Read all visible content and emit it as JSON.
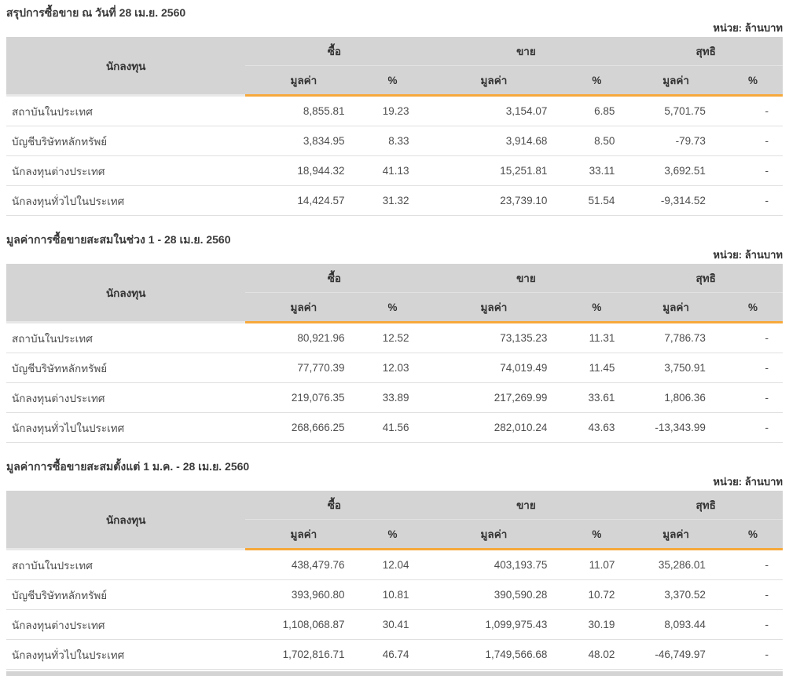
{
  "unit_label": "หน่วย: ล้านบาท",
  "columns": {
    "investor": "นักลงทุน",
    "buy": "ซื้อ",
    "sell": "ขาย",
    "net": "สุทธิ",
    "value": "มูลค่า",
    "percent": "%"
  },
  "colors": {
    "header_gray": "#d4d4d4",
    "accent_orange": "#f6a93b",
    "positive_green": "#109910",
    "negative_red": "#ff0000"
  },
  "sections": [
    {
      "title": "สรุปการซื้อขาย ณ วันที่ 28 เม.ย. 2560",
      "rows": [
        {
          "investor": "สถาบันในประเทศ",
          "buy_value": "8,855.81",
          "buy_pct": "19.23",
          "sell_value": "3,154.07",
          "sell_pct": "6.85",
          "net_value": "5,701.75",
          "net_pct": "-"
        },
        {
          "investor": "บัญชีบริษัทหลักทรัพย์",
          "buy_value": "3,834.95",
          "buy_pct": "8.33",
          "sell_value": "3,914.68",
          "sell_pct": "8.50",
          "net_value": "-79.73",
          "net_pct": "-"
        },
        {
          "investor": "นักลงทุนต่างประเทศ",
          "buy_value": "18,944.32",
          "buy_pct": "41.13",
          "sell_value": "15,251.81",
          "sell_pct": "33.11",
          "net_value": "3,692.51",
          "net_pct": "-"
        },
        {
          "investor": "นักลงทุนทั่วไปในประเทศ",
          "buy_value": "14,424.57",
          "buy_pct": "31.32",
          "sell_value": "23,739.10",
          "sell_pct": "51.54",
          "net_value": "-9,314.52",
          "net_pct": "-"
        }
      ]
    },
    {
      "title": "มูลค่าการซื้อขายสะสมในช่วง 1 - 28 เม.ย. 2560",
      "rows": [
        {
          "investor": "สถาบันในประเทศ",
          "buy_value": "80,921.96",
          "buy_pct": "12.52",
          "sell_value": "73,135.23",
          "sell_pct": "11.31",
          "net_value": "7,786.73",
          "net_pct": "-"
        },
        {
          "investor": "บัญชีบริษัทหลักทรัพย์",
          "buy_value": "77,770.39",
          "buy_pct": "12.03",
          "sell_value": "74,019.49",
          "sell_pct": "11.45",
          "net_value": "3,750.91",
          "net_pct": "-"
        },
        {
          "investor": "นักลงทุนต่างประเทศ",
          "buy_value": "219,076.35",
          "buy_pct": "33.89",
          "sell_value": "217,269.99",
          "sell_pct": "33.61",
          "net_value": "1,806.36",
          "net_pct": "-"
        },
        {
          "investor": "นักลงทุนทั่วไปในประเทศ",
          "buy_value": "268,666.25",
          "buy_pct": "41.56",
          "sell_value": "282,010.24",
          "sell_pct": "43.63",
          "net_value": "-13,343.99",
          "net_pct": "-"
        }
      ]
    },
    {
      "title": "มูลค่าการซื้อขายสะสมตั้งแต่ 1 ม.ค. - 28 เม.ย. 2560",
      "rows": [
        {
          "investor": "สถาบันในประเทศ",
          "buy_value": "438,479.76",
          "buy_pct": "12.04",
          "sell_value": "403,193.75",
          "sell_pct": "11.07",
          "net_value": "35,286.01",
          "net_pct": "-"
        },
        {
          "investor": "บัญชีบริษัทหลักทรัพย์",
          "buy_value": "393,960.80",
          "buy_pct": "10.81",
          "sell_value": "390,590.28",
          "sell_pct": "10.72",
          "net_value": "3,370.52",
          "net_pct": "-"
        },
        {
          "investor": "นักลงทุนต่างประเทศ",
          "buy_value": "1,108,068.87",
          "buy_pct": "30.41",
          "sell_value": "1,099,975.43",
          "sell_pct": "30.19",
          "net_value": "8,093.44",
          "net_pct": "-"
        },
        {
          "investor": "นักลงทุนทั่วไปในประเทศ",
          "buy_value": "1,702,816.71",
          "buy_pct": "46.74",
          "sell_value": "1,749,566.68",
          "sell_pct": "48.02",
          "net_value": "-46,749.97",
          "net_pct": "-"
        }
      ]
    }
  ]
}
